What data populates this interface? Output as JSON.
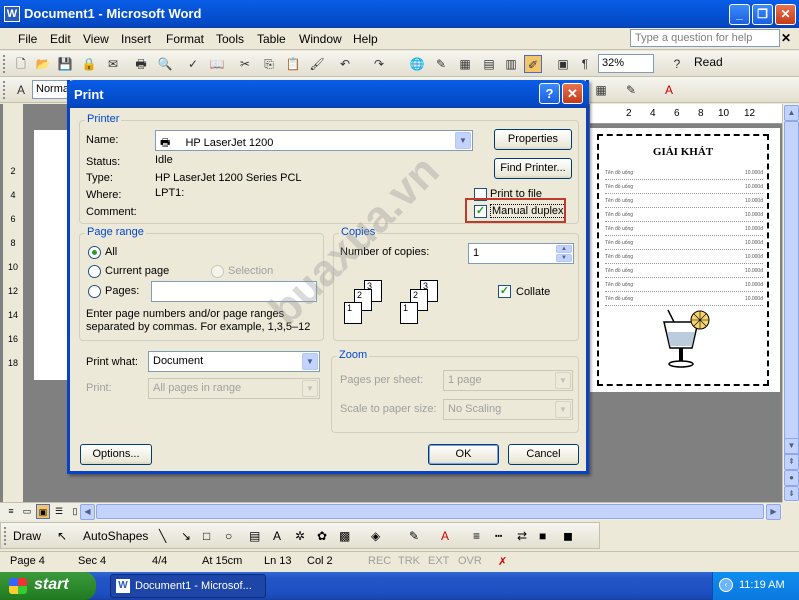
{
  "window": {
    "title": "Document1 - Microsoft Word",
    "min": "_",
    "max": "❐",
    "close": "✕"
  },
  "menu": [
    "File",
    "Edit",
    "View",
    "Insert",
    "Format",
    "Tools",
    "Table",
    "Window",
    "Help"
  ],
  "ask_box": {
    "placeholder": "Type a question for help"
  },
  "toolbar": {
    "zoom": "32%",
    "read": "Read",
    "style": "Normal"
  },
  "ruler": {
    "v": [
      "2",
      "4",
      "6",
      "8",
      "10",
      "12",
      "14",
      "16",
      "18"
    ],
    "h": [
      "2",
      "4",
      "6",
      "8",
      "10",
      "12"
    ]
  },
  "menu_card": {
    "title": "GIẢI KHÁT",
    "rows": [
      {
        "name": "Tên đồ uống",
        "price": "10.000đ"
      },
      {
        "name": "Tên đồ uống",
        "price": "10.000đ"
      },
      {
        "name": "Tên đồ uống",
        "price": "10.000đ"
      },
      {
        "name": "Tên đồ uống",
        "price": "10.000đ"
      },
      {
        "name": "Tên đồ uống",
        "price": "10.000đ"
      },
      {
        "name": "Tên đồ uống",
        "price": "10.000đ"
      },
      {
        "name": "Tên đồ uống",
        "price": "10.000đ"
      },
      {
        "name": "Tên đồ uống",
        "price": "10.000đ"
      },
      {
        "name": "Tên đồ uống",
        "price": "10.000đ"
      },
      {
        "name": "Tên đồ uống",
        "price": "10.000đ"
      }
    ]
  },
  "dialog": {
    "title": "Print",
    "help": "?",
    "close": "✕",
    "printer": {
      "legend": "Printer",
      "name_label": "Name:",
      "name_value": "HP LaserJet 1200",
      "status_label": "Status:",
      "status_value": "Idle",
      "type_label": "Type:",
      "type_value": "HP LaserJet 1200 Series PCL",
      "where_label": "Where:",
      "where_value": "LPT1:",
      "comment_label": "Comment:",
      "properties": "Properties",
      "find_printer": "Find Printer...",
      "print_to_file": "Print to file",
      "manual_duplex": "Manual duplex"
    },
    "page_range": {
      "legend": "Page range",
      "all": "All",
      "current_page": "Current page",
      "selection": "Selection",
      "pages": "Pages:",
      "hint": "Enter page numbers and/or page ranges separated by commas.  For example, 1,3,5–12"
    },
    "copies": {
      "legend": "Copies",
      "number_label": "Number of copies:",
      "number_value": "1",
      "collate": "Collate",
      "icons": [
        "3",
        "2",
        "1",
        "3",
        "2",
        "1"
      ]
    },
    "print_what": {
      "label": "Print what:",
      "value": "Document"
    },
    "print": {
      "label": "Print:",
      "value": "All pages in range"
    },
    "zoom": {
      "legend": "Zoom",
      "pps_label": "Pages per sheet:",
      "pps_value": "1 page",
      "scale_label": "Scale to paper size:",
      "scale_value": "No Scaling"
    },
    "buttons": {
      "options": "Options...",
      "ok": "OK",
      "cancel": "Cancel"
    }
  },
  "watermark": "buaxua.vn",
  "drawbar": {
    "draw": "Draw",
    "autoshapes": "AutoShapes"
  },
  "status": {
    "page": "Page 4",
    "sec": "Sec 4",
    "count": "4/4",
    "at": "At 15cm",
    "ln": "Ln 13",
    "col": "Col 2",
    "rec": "REC",
    "trk": "TRK",
    "ext": "EXT",
    "ovr": "OVR"
  },
  "taskbar": {
    "start": "start",
    "item": "Document1 - Microsof...",
    "clock": "11:19 AM"
  }
}
